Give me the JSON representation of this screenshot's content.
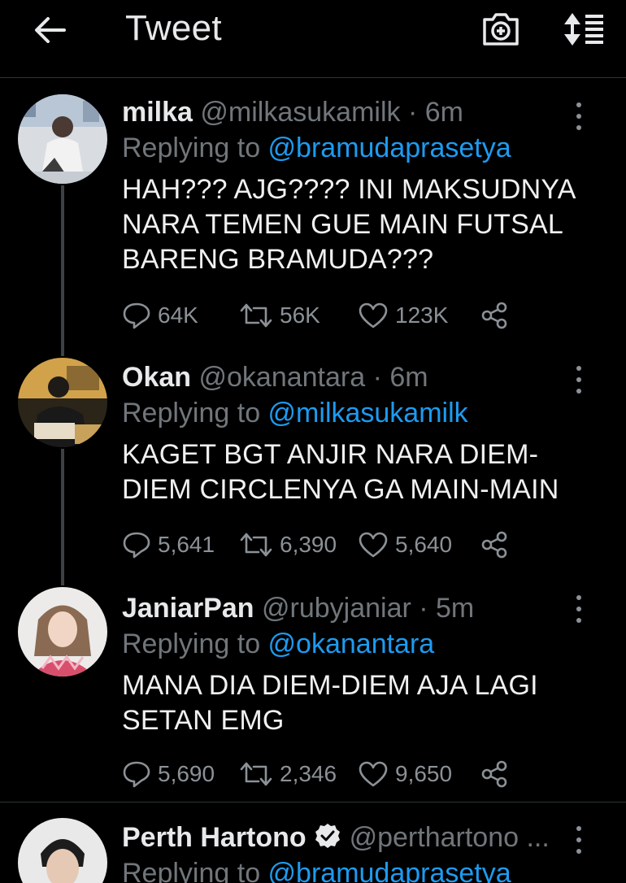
{
  "header": {
    "title": "Tweet"
  },
  "tweets": [
    {
      "name": "milka",
      "handle": "@milkasukamilk · 6m",
      "replying_label": "Replying to ",
      "replying_to": "@bramudaprasetya",
      "text_lines": [
        "HAH??? AJG???? INI MAKSUDNYA",
        "NARA TEMEN GUE MAIN FUTSAL",
        "BARENG BRAMUDA???"
      ],
      "replies": "64K",
      "retweets": "56K",
      "likes": "123K"
    },
    {
      "name": "Okan",
      "handle": "@okanantara · 6m",
      "replying_label": "Replying to ",
      "replying_to": "@milkasukamilk",
      "text_lines": [
        "KAGET BGT ANJIR NARA DIEM-",
        "DIEM CIRCLENYA GA MAIN-MAIN"
      ],
      "replies": "5,641",
      "retweets": "6,390",
      "likes": "5,640"
    },
    {
      "name": "JaniarPan",
      "handle": "@rubyjaniar · 5m",
      "replying_label": "Replying to ",
      "replying_to": "@okanantara",
      "text_lines": [
        "MANA DIA DIEM-DIEM AJA LAGI",
        "SETAN EMG"
      ],
      "replies": "5,690",
      "retweets": "2,346",
      "likes": "9,650"
    },
    {
      "name": "Perth Hartono",
      "handle": "@perthartono ...",
      "replying_label": "Replying to ",
      "replying_to": "@bramudaprasetya"
    }
  ],
  "colors": {
    "accent": "#1d9bf0",
    "muted": "#71767b",
    "background": "#000000"
  }
}
